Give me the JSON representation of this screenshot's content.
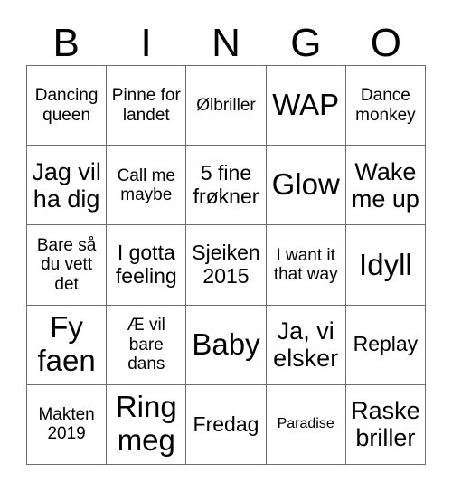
{
  "card": {
    "title": "BINGO",
    "header_letters": [
      "B",
      "I",
      "N",
      "G",
      "O"
    ],
    "colors": {
      "background": "#ffffff",
      "grid_line": "#6d6d6d",
      "text": "#000000"
    },
    "rows": [
      [
        {
          "text": "Dancing queen",
          "size": "md"
        },
        {
          "text": "Pinne for landet",
          "size": "md"
        },
        {
          "text": "Ølbriller",
          "size": "md"
        },
        {
          "text": "WAP",
          "size": "xxl"
        },
        {
          "text": "Dance monkey",
          "size": "md"
        }
      ],
      [
        {
          "text": "Jag vil ha dig",
          "size": "xl"
        },
        {
          "text": "Call me maybe",
          "size": "md"
        },
        {
          "text": "5 fine frøkner",
          "size": "lg"
        },
        {
          "text": "Glow",
          "size": "xxl"
        },
        {
          "text": "Wake me up",
          "size": "xl"
        }
      ],
      [
        {
          "text": "Bare så du vett det",
          "size": "md"
        },
        {
          "text": "I gotta feeling",
          "size": "lg"
        },
        {
          "text": "Sjeiken 2015",
          "size": "lg"
        },
        {
          "text": "I want it that way",
          "size": "md"
        },
        {
          "text": "Idyll",
          "size": "xxl"
        }
      ],
      [
        {
          "text": "Fy faen",
          "size": "xxl"
        },
        {
          "text": "Æ vil bare dans",
          "size": "md"
        },
        {
          "text": "Baby",
          "size": "xxl"
        },
        {
          "text": "Ja, vi elsker",
          "size": "xl"
        },
        {
          "text": "Replay",
          "size": "lg"
        }
      ],
      [
        {
          "text": "Makten 2019",
          "size": "md"
        },
        {
          "text": "Ring meg",
          "size": "xxl"
        },
        {
          "text": "Fredag",
          "size": "lg"
        },
        {
          "text": "Paradise",
          "size": "sm"
        },
        {
          "text": "Raske briller",
          "size": "xl"
        }
      ]
    ]
  }
}
